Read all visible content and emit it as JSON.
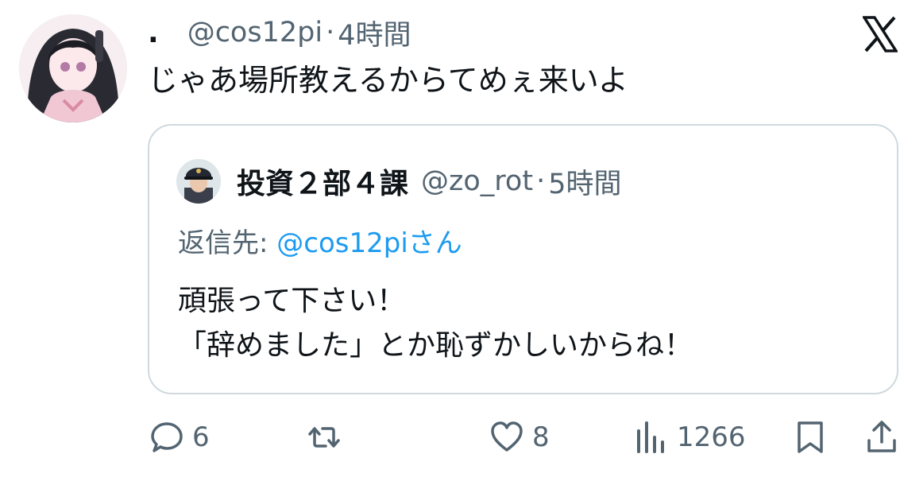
{
  "tweet": {
    "author_name": ".",
    "handle": "@cos12pi",
    "separator": "·",
    "time": "4時間",
    "text": "じゃあ場所教えるからてめぇ来いよ"
  },
  "quoted": {
    "author_name": "投資２部４課",
    "handle": "@zo_rot",
    "separator": "·",
    "time": "5時間",
    "reply_prefix": "返信先: ",
    "reply_mention": "@cos12piさん",
    "text_lines": [
      "頑張って下さい！",
      "「辞めました」とか恥ずかしいからね！"
    ]
  },
  "actions": {
    "replies": "6",
    "retweets": "",
    "likes": "8",
    "views": "1266"
  },
  "icons": {
    "app_logo": "x-logo-icon",
    "reply": "speech-bubble-icon",
    "retweet": "retweet-icon",
    "like": "heart-icon",
    "views": "bar-chart-icon",
    "bookmark": "bookmark-icon",
    "share": "share-icon"
  },
  "colors": {
    "text_primary": "#0f1419",
    "text_secondary": "#536471",
    "link": "#1d9bf0",
    "border": "#cfd9de"
  }
}
